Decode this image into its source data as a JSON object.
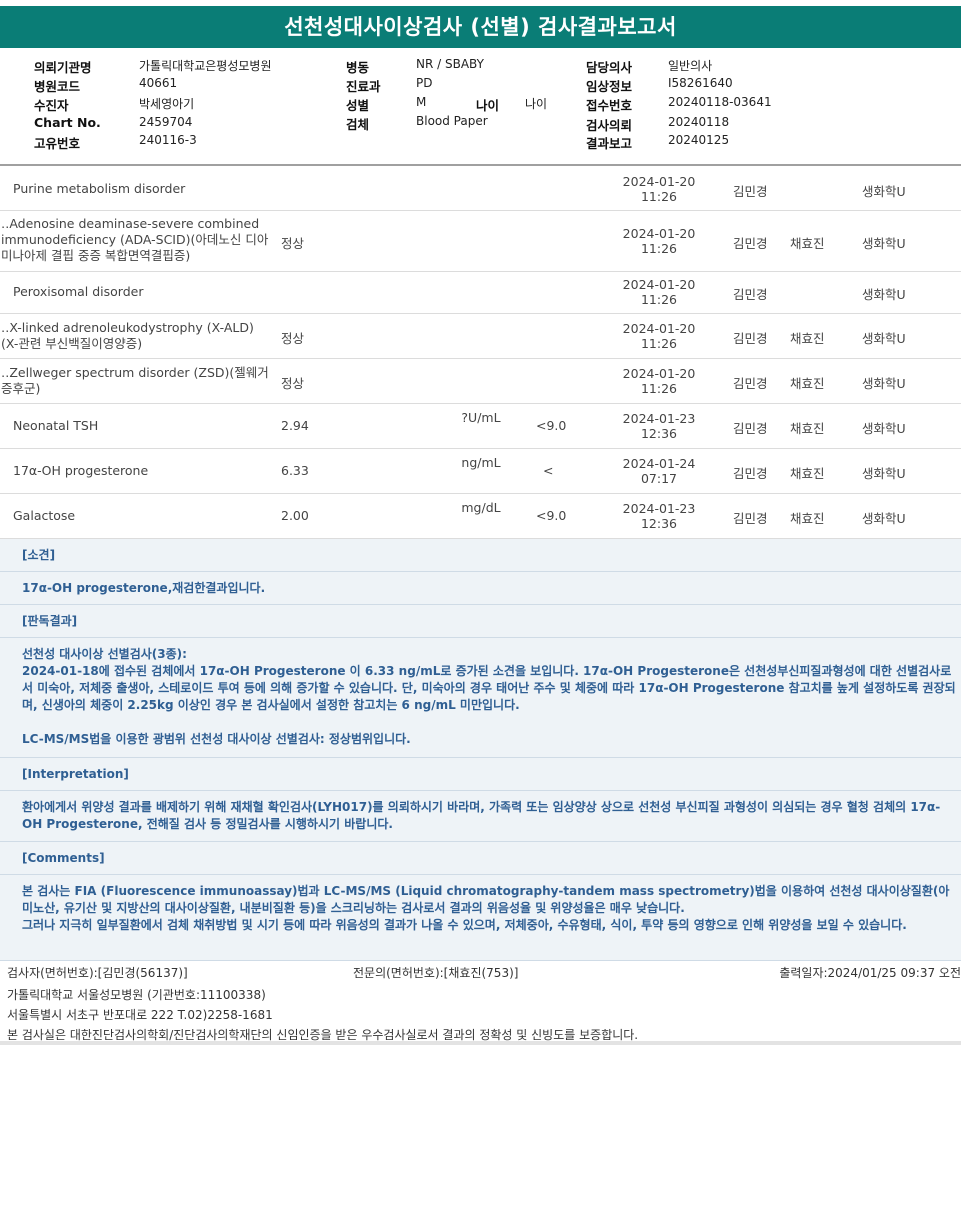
{
  "title": "선천성대사이상검사 (선별) 검사결과보고서",
  "header": {
    "institution_label": "의뢰기관명",
    "institution": "가톨릭대학교은평성모병원",
    "hospital_code_label": "병원코드",
    "hospital_code": "40661",
    "patient_label": "수진자",
    "patient": "박세영아기",
    "chart_no_label": "Chart No.",
    "chart_no": "2459704",
    "unique_no_label": "고유번호",
    "unique_no": "240116-3",
    "ward_label": "병동",
    "ward": "NR / SBABY",
    "dept_label": "진료과",
    "dept": "PD",
    "sex_label": "성별",
    "sex": "M",
    "age_label": "나이",
    "age": "나이",
    "specimen_label": "검체",
    "specimen": "Blood Paper",
    "doctor_label": "담당의사",
    "doctor": "일반의사",
    "clinical_label": "임상정보",
    "clinical": "I58261640",
    "receipt_label": "접수번호",
    "receipt": "20240118-03641",
    "request_label": "검사의뢰",
    "request": "20240118",
    "report_label": "결과보고",
    "report": "20240125"
  },
  "results": [
    {
      "name": "Purine metabolism disorder",
      "result": "",
      "unit": "",
      "ref": "",
      "date": "2024-01-20",
      "time": "11:26",
      "tester": "김민경",
      "confirmer": "",
      "dept": "생화학U"
    },
    {
      "name": "‥Adenosine deaminase-severe combined immunodeficiency (ADA-SCID)(아데노신 디아미나아제 결핍 중증 복합면역결핍증)",
      "result": "정상",
      "unit": "",
      "ref": "",
      "date": "2024-01-20",
      "time": "11:26",
      "tester": "김민경",
      "confirmer": "채효진",
      "dept": "생화학U"
    },
    {
      "name": "Peroxisomal disorder",
      "result": "",
      "unit": "",
      "ref": "",
      "date": "2024-01-20",
      "time": "11:26",
      "tester": "김민경",
      "confirmer": "",
      "dept": "생화학U"
    },
    {
      "name": "‥X-linked adrenoleukodystrophy (X-ALD)(X-관련 부신백질이영양증)",
      "result": "정상",
      "unit": "",
      "ref": "",
      "date": "2024-01-20",
      "time": "11:26",
      "tester": "김민경",
      "confirmer": "채효진",
      "dept": "생화학U"
    },
    {
      "name": "‥Zellweger spectrum disorder (ZSD)(젤웨거 증후군)",
      "result": "정상",
      "unit": "",
      "ref": "",
      "date": "2024-01-20",
      "time": "11:26",
      "tester": "김민경",
      "confirmer": "채효진",
      "dept": "생화학U"
    },
    {
      "name": "Neonatal TSH",
      "result": "2.94",
      "unit": "?U/mL",
      "ref": "<9.0",
      "date": "2024-01-23",
      "time": "12:36",
      "tester": "김민경",
      "confirmer": "채효진",
      "dept": "생화학U"
    },
    {
      "name": "17α-OH progesterone",
      "result": "6.33",
      "unit": "ng/mL",
      "ref": "<",
      "date": "2024-01-24",
      "time": "07:17",
      "tester": "김민경",
      "confirmer": "채효진",
      "dept": "생화학U"
    },
    {
      "name": "Galactose",
      "result": "2.00",
      "unit": "mg/dL",
      "ref": "<9.0",
      "date": "2024-01-23",
      "time": "12:36",
      "tester": "김민경",
      "confirmer": "채효진",
      "dept": "생화학U"
    }
  ],
  "notes": {
    "finding_title": "[소견]",
    "finding_text": "17α-OH progesterone,재검한결과입니다.",
    "judgement_title": "[판독결과]",
    "judgement_text_1": "선천성 대사이상 선별검사(3종):",
    "judgement_text_2": "2024-01-18에 접수된 검체에서 17α-OH Progesterone 이 6.33 ng/mL로 증가된 소견을 보입니다. 17α-OH Progesterone은 선천성부신피질과형성에 대한 선별검사로서 미숙아, 저체중 출생아, 스테로이드 투여 등에 의해 증가할 수 있습니다. 단, 미숙아의 경우 태어난 주수 및 체중에 따라 17α-OH Progesterone 참고치를 높게 설정하도록 권장되며, 신생아의 체중이 2.25kg 이상인 경우 본 검사실에서 설정한 참고치는 6 ng/mL 미만입니다.",
    "judgement_text_3": "LC-MS/MS법을 이용한 광범위 선천성 대사이상 선별검사: 정상범위입니다.",
    "interpretation_title": "[Interpretation]",
    "interpretation_text": "환아에게서 위양성 결과를 배제하기 위해 재채혈 확인검사(LYH017)를 의뢰하시기 바라며, 가족력 또는 임상양상 상으로 선천성 부신피질 과형성이 의심되는 경우 혈청 검체의 17α-OH Progesterone, 전해질 검사 등 정밀검사를 시행하시기 바랍니다.",
    "comments_title": "[Comments]",
    "comments_text_1": "본 검사는 FIA (Fluorescence immunoassay)법과 LC-MS/MS (Liquid chromatography-tandem mass spectrometry)법을 이용하여 선천성 대사이상질환(아미노산, 유기산 및 지방산의 대사이상질환, 내분비질환 등)을 스크리닝하는 검사로서 결과의 위음성율 및 위양성율은 매우 낮습니다.",
    "comments_text_2": "그러나 지극히 일부질환에서 검체 채취방법 및 시기 등에 따라 위음성의 결과가 나올 수 있으며, 저체중아, 수유형태, 식이, 투약 등의 영향으로 인해 위양성을 보일 수 있습니다."
  },
  "footer": {
    "tester": "검사자(면허번호):[김민경(56137)]",
    "specialist": "전문의(면허번호):[채효진(753)]",
    "printed": "출력일자:2024/01/25 09:37 오전",
    "lab_name": "가톨릭대학교 서울성모병원 (기관번호:11100338)",
    "address": "서울특별시 서초구 반포대로 222 T.02)2258-1681",
    "certification": "본 검사실은 대한진단검사의학회/진단검사의학재단의 신임인증을 받은 우수검사실로서 결과의 정확성 및 신빙도를 보증합니다."
  }
}
